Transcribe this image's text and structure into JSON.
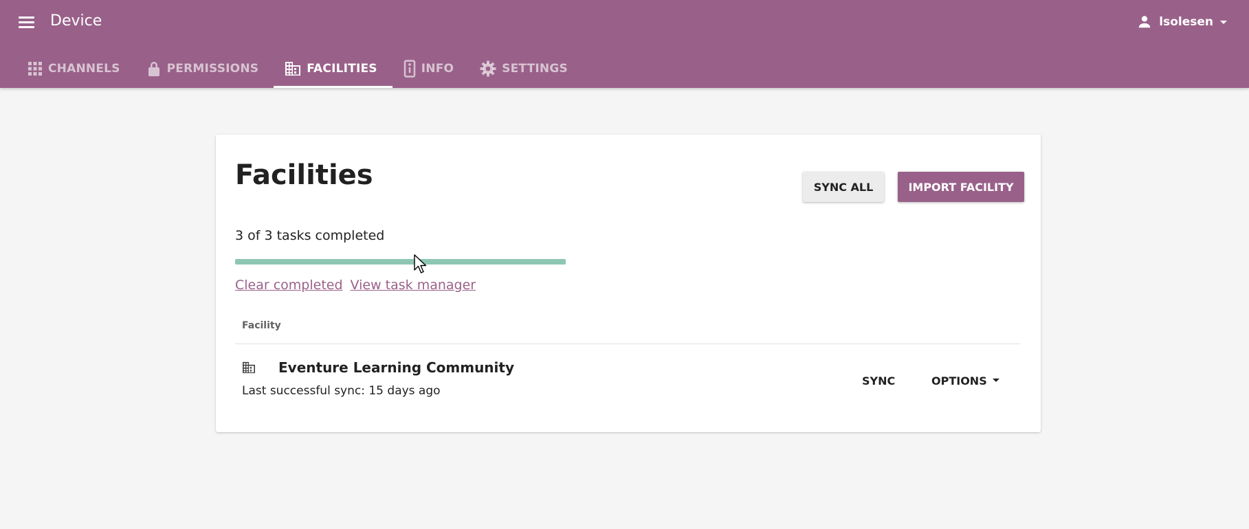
{
  "app": {
    "title": "Device"
  },
  "user": {
    "name": "lsolesen"
  },
  "tabs": [
    {
      "label": "CHANNELS",
      "icon": "apps-grid-icon",
      "active": false
    },
    {
      "label": "PERMISSIONS",
      "icon": "lock-icon",
      "active": false
    },
    {
      "label": "FACILITIES",
      "icon": "building-icon",
      "active": true
    },
    {
      "label": "INFO",
      "icon": "device-info-icon",
      "active": false
    },
    {
      "label": "SETTINGS",
      "icon": "gear-icon",
      "active": false
    }
  ],
  "page": {
    "title": "Facilities",
    "sync_all_label": "SYNC ALL",
    "import_label": "IMPORT FACILITY",
    "task_status": "3 of 3 tasks completed",
    "progress_fraction": 1.0,
    "clear_completed_label": "Clear completed",
    "view_task_manager_label": "View task manager"
  },
  "table": {
    "header": "Facility",
    "rows": [
      {
        "name": "Eventure Learning Community",
        "last_sync": "Last successful sync: 15 days ago",
        "sync_label": "SYNC",
        "options_label": "OPTIONS"
      }
    ]
  },
  "colors": {
    "brand": "#996189",
    "progress": "#8ec6b3",
    "background": "#f5f5f5"
  }
}
